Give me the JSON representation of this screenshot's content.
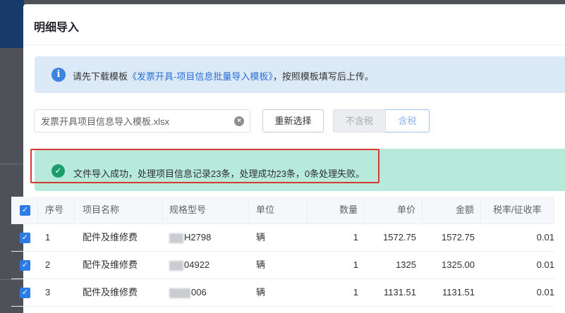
{
  "dialog": {
    "title": "明细导入"
  },
  "info_alert": {
    "icon": "info-icon",
    "prefix": "请先下载模板",
    "link": "《发票开具-项目信息批量导入模板》",
    "suffix": "，按照模板填写后上传。"
  },
  "file": {
    "value": "发票开具项目信息导入模板.xlsx",
    "clear_icon": "close-circle-icon",
    "reselect_label": "重新选择"
  },
  "tax_toggle": {
    "options": [
      "不含税",
      "含税"
    ],
    "selected": "含税"
  },
  "success_alert": {
    "icon": "check-circle-icon",
    "message": "文件导入成功，处理项目信息记录23条，处理成功23条，0条处理失败。"
  },
  "table": {
    "columns": [
      "序号",
      "项目名称",
      "规格型号",
      "单位",
      "数量",
      "单价",
      "金额",
      "税率/征收率"
    ],
    "rows": [
      {
        "no": "1",
        "name": "配件及维修费",
        "spec": "H2798",
        "unit": "辆",
        "qty": "1",
        "price": "1572.75",
        "amount": "1572.75",
        "tax": "0.01"
      },
      {
        "no": "2",
        "name": "配件及维修费",
        "spec": "04922",
        "unit": "辆",
        "qty": "1",
        "price": "1325",
        "amount": "1325.00",
        "tax": "0.01"
      },
      {
        "no": "3",
        "name": "配件及维修费",
        "spec": "006",
        "unit": "辆",
        "qty": "1",
        "price": "1131.51",
        "amount": "1131.51",
        "tax": "0.01"
      }
    ]
  },
  "colors": {
    "primary": "#2d7be5",
    "info_bg": "#dceaf8",
    "success_bg": "#b8eadb",
    "highlight": "#d93a2f"
  }
}
